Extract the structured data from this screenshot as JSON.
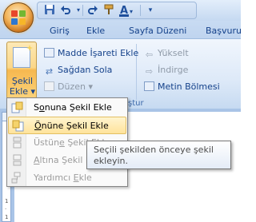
{
  "quick_access": {
    "icons": [
      "save-icon",
      "undo-icon",
      "redo-icon",
      "format-painter-icon",
      "font-color-icon",
      "customize-qat-icon"
    ]
  },
  "tabs": [
    "Giriş",
    "Ekle",
    "Sayfa Düzeni",
    "Başvuru"
  ],
  "ribbon": {
    "sekil_ekle": {
      "line1": "Şekil",
      "line2": "Ekle ▾"
    },
    "madde_isareti_ekle": "Madde İşareti Ekle",
    "sagdan_sola": "Sağdan Sola",
    "duzen": "Düzen ▾",
    "yukselt": "Yükselt",
    "indirge": "İndirge",
    "metin_bolmesi": "Metin Bölmesi",
    "group_label_partial": "ştur"
  },
  "menu": {
    "items": [
      {
        "pre": "S",
        "u": "o",
        "post": "nuna Şekil Ekle",
        "enabled": true,
        "highlighted": false
      },
      {
        "pre": "",
        "u": "Ö",
        "post": "nüne Şekil Ekle",
        "enabled": true,
        "highlighted": true
      },
      {
        "pre": "Üstün",
        "u": "e",
        "post": " Şekil Ekle",
        "enabled": false,
        "highlighted": false
      },
      {
        "pre": "",
        "u": "A",
        "post": "ltına Şekil Ekle",
        "enabled": false,
        "highlighted": false
      },
      {
        "pre": "Yardımcı ",
        "u": "E",
        "post": "kle",
        "enabled": false,
        "highlighted": false
      }
    ]
  },
  "tooltip": {
    "line1": "Seçili şekilden önceye şekil",
    "line2": "ekleyin."
  },
  "ruler": {
    "ticks": [
      "1",
      "·",
      "1",
      "·",
      "2",
      "·",
      "3"
    ]
  }
}
